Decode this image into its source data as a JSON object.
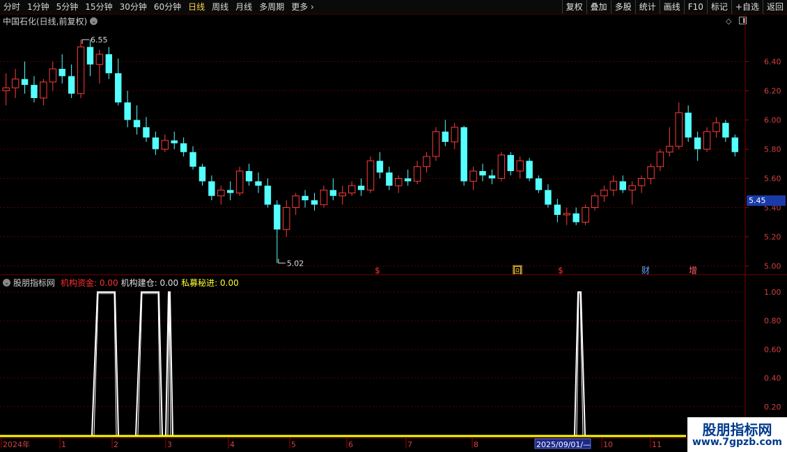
{
  "toolbar": {
    "periods": [
      "分时",
      "1分钟",
      "5分钟",
      "15分钟",
      "30分钟",
      "60分钟",
      "日线",
      "周线",
      "月线",
      "多周期",
      "更多"
    ],
    "active_index": 6,
    "more_arrow": "›",
    "right_buttons": [
      "复权",
      "叠加",
      "多股",
      "统计",
      "画线",
      "F10",
      "标记",
      "+自选",
      "返回"
    ]
  },
  "main_chart": {
    "title": "中国石化(日线,前复权)",
    "high_label": "6.55",
    "low_label": "5.02",
    "current_price": "5.45",
    "y_ticks": [
      "6.40",
      "6.20",
      "6.00",
      "5.80",
      "5.60",
      "5.40",
      "5.20",
      "5.00"
    ],
    "markers": [
      {
        "text": "$",
        "color": "#ff3030"
      },
      {
        "text": "回",
        "color": "#ffcc33"
      },
      {
        "text": "$",
        "color": "#ff3030"
      },
      {
        "text": "财",
        "color": "#66a3ff"
      },
      {
        "text": "增",
        "color": "#ff6060"
      }
    ]
  },
  "indicator": {
    "name": "股朋指标网",
    "items": [
      {
        "label": "机构资金:",
        "value": "0.00",
        "color": "#ff3030"
      },
      {
        "label": "机构建仓:",
        "value": "0.00",
        "color": "#e0e0e0"
      },
      {
        "label": "私募秘进:",
        "value": "0.00",
        "color": "#ffff33"
      }
    ],
    "y_ticks": [
      "1.00",
      "0.80",
      "0.60",
      "0.40",
      "0.20"
    ]
  },
  "x_axis": {
    "labels": [
      "2024年",
      "1",
      "2",
      "3",
      "4",
      "5",
      "6",
      "7",
      "8",
      "2025/09/01/—",
      "10",
      "11"
    ]
  },
  "watermark": {
    "line1": "股朋指标网",
    "line2": "www.7gpzb.com"
  },
  "chart_data": {
    "type": "candlestick",
    "title": "中国石化(日线,前复权)",
    "ylim": [
      4.95,
      6.65
    ],
    "candles_ohlc_sampled": [
      [
        6.2,
        6.32,
        6.1,
        6.22
      ],
      [
        6.22,
        6.35,
        6.15,
        6.28
      ],
      [
        6.28,
        6.4,
        6.18,
        6.24
      ],
      [
        6.24,
        6.3,
        6.12,
        6.15
      ],
      [
        6.15,
        6.28,
        6.1,
        6.26
      ],
      [
        6.26,
        6.4,
        6.2,
        6.35
      ],
      [
        6.35,
        6.45,
        6.25,
        6.3
      ],
      [
        6.3,
        6.38,
        6.15,
        6.18
      ],
      [
        6.18,
        6.55,
        6.15,
        6.5
      ],
      [
        6.5,
        6.55,
        6.3,
        6.38
      ],
      [
        6.38,
        6.48,
        6.25,
        6.45
      ],
      [
        6.45,
        6.5,
        6.28,
        6.32
      ],
      [
        6.32,
        6.42,
        6.1,
        6.12
      ],
      [
        6.12,
        6.2,
        5.95,
        6.0
      ],
      [
        6.0,
        6.1,
        5.9,
        5.95
      ],
      [
        5.95,
        6.02,
        5.85,
        5.88
      ],
      [
        5.88,
        5.92,
        5.76,
        5.8
      ],
      [
        5.8,
        5.9,
        5.78,
        5.86
      ],
      [
        5.86,
        5.92,
        5.8,
        5.84
      ],
      [
        5.84,
        5.88,
        5.75,
        5.78
      ],
      [
        5.78,
        5.82,
        5.66,
        5.68
      ],
      [
        5.68,
        5.7,
        5.55,
        5.58
      ],
      [
        5.58,
        5.62,
        5.45,
        5.48
      ],
      [
        5.48,
        5.55,
        5.42,
        5.52
      ],
      [
        5.52,
        5.58,
        5.45,
        5.5
      ],
      [
        5.5,
        5.68,
        5.48,
        5.65
      ],
      [
        5.65,
        5.7,
        5.55,
        5.58
      ],
      [
        5.58,
        5.64,
        5.5,
        5.55
      ],
      [
        5.55,
        5.6,
        5.4,
        5.42
      ],
      [
        5.42,
        5.45,
        5.02,
        5.25
      ],
      [
        5.25,
        5.45,
        5.2,
        5.4
      ],
      [
        5.4,
        5.5,
        5.35,
        5.48
      ],
      [
        5.48,
        5.52,
        5.4,
        5.45
      ],
      [
        5.45,
        5.5,
        5.38,
        5.42
      ],
      [
        5.42,
        5.55,
        5.4,
        5.52
      ],
      [
        5.52,
        5.6,
        5.45,
        5.48
      ],
      [
        5.48,
        5.55,
        5.42,
        5.5
      ],
      [
        5.5,
        5.58,
        5.48,
        5.55
      ],
      [
        5.55,
        5.6,
        5.48,
        5.52
      ],
      [
        5.52,
        5.75,
        5.5,
        5.72
      ],
      [
        5.72,
        5.78,
        5.6,
        5.64
      ],
      [
        5.64,
        5.68,
        5.52,
        5.55
      ],
      [
        5.55,
        5.62,
        5.5,
        5.6
      ],
      [
        5.6,
        5.66,
        5.55,
        5.58
      ],
      [
        5.58,
        5.72,
        5.56,
        5.68
      ],
      [
        5.68,
        5.78,
        5.64,
        5.75
      ],
      [
        5.75,
        5.95,
        5.72,
        5.92
      ],
      [
        5.92,
        6.0,
        5.82,
        5.85
      ],
      [
        5.85,
        5.98,
        5.8,
        5.95
      ],
      [
        5.95,
        5.96,
        5.55,
        5.58
      ],
      [
        5.58,
        5.68,
        5.52,
        5.65
      ],
      [
        5.65,
        5.7,
        5.58,
        5.62
      ],
      [
        5.62,
        5.66,
        5.56,
        5.6
      ],
      [
        5.6,
        5.78,
        5.58,
        5.76
      ],
      [
        5.76,
        5.78,
        5.62,
        5.65
      ],
      [
        5.65,
        5.75,
        5.6,
        5.72
      ],
      [
        5.72,
        5.74,
        5.58,
        5.6
      ],
      [
        5.6,
        5.62,
        5.5,
        5.52
      ],
      [
        5.52,
        5.56,
        5.4,
        5.42
      ],
      [
        5.42,
        5.46,
        5.3,
        5.35
      ],
      [
        5.35,
        5.4,
        5.28,
        5.36
      ],
      [
        5.36,
        5.4,
        5.28,
        5.3
      ],
      [
        5.3,
        5.42,
        5.28,
        5.4
      ],
      [
        5.4,
        5.5,
        5.38,
        5.48
      ],
      [
        5.48,
        5.55,
        5.44,
        5.52
      ],
      [
        5.52,
        5.62,
        5.48,
        5.58
      ],
      [
        5.58,
        5.62,
        5.5,
        5.52
      ],
      [
        5.52,
        5.58,
        5.42,
        5.55
      ],
      [
        5.55,
        5.62,
        5.5,
        5.6
      ],
      [
        5.6,
        5.7,
        5.56,
        5.68
      ],
      [
        5.68,
        5.8,
        5.65,
        5.78
      ],
      [
        5.78,
        5.95,
        5.75,
        5.82
      ],
      [
        5.82,
        6.12,
        5.8,
        6.05
      ],
      [
        6.05,
        6.1,
        5.85,
        5.88
      ],
      [
        5.88,
        5.92,
        5.72,
        5.8
      ],
      [
        5.8,
        5.95,
        5.78,
        5.92
      ],
      [
        5.92,
        6.02,
        5.88,
        5.98
      ],
      [
        5.98,
        6.0,
        5.85,
        5.88
      ],
      [
        5.88,
        5.9,
        5.75,
        5.78
      ]
    ],
    "indicator_series": {
      "name": "机构资金",
      "spikes": [
        [
          1.0,
          "2024-01"
        ],
        [
          1.0,
          "2024-02"
        ],
        [
          1.0,
          "2024-03"
        ],
        [
          1.0,
          "2025-09"
        ]
      ]
    }
  }
}
